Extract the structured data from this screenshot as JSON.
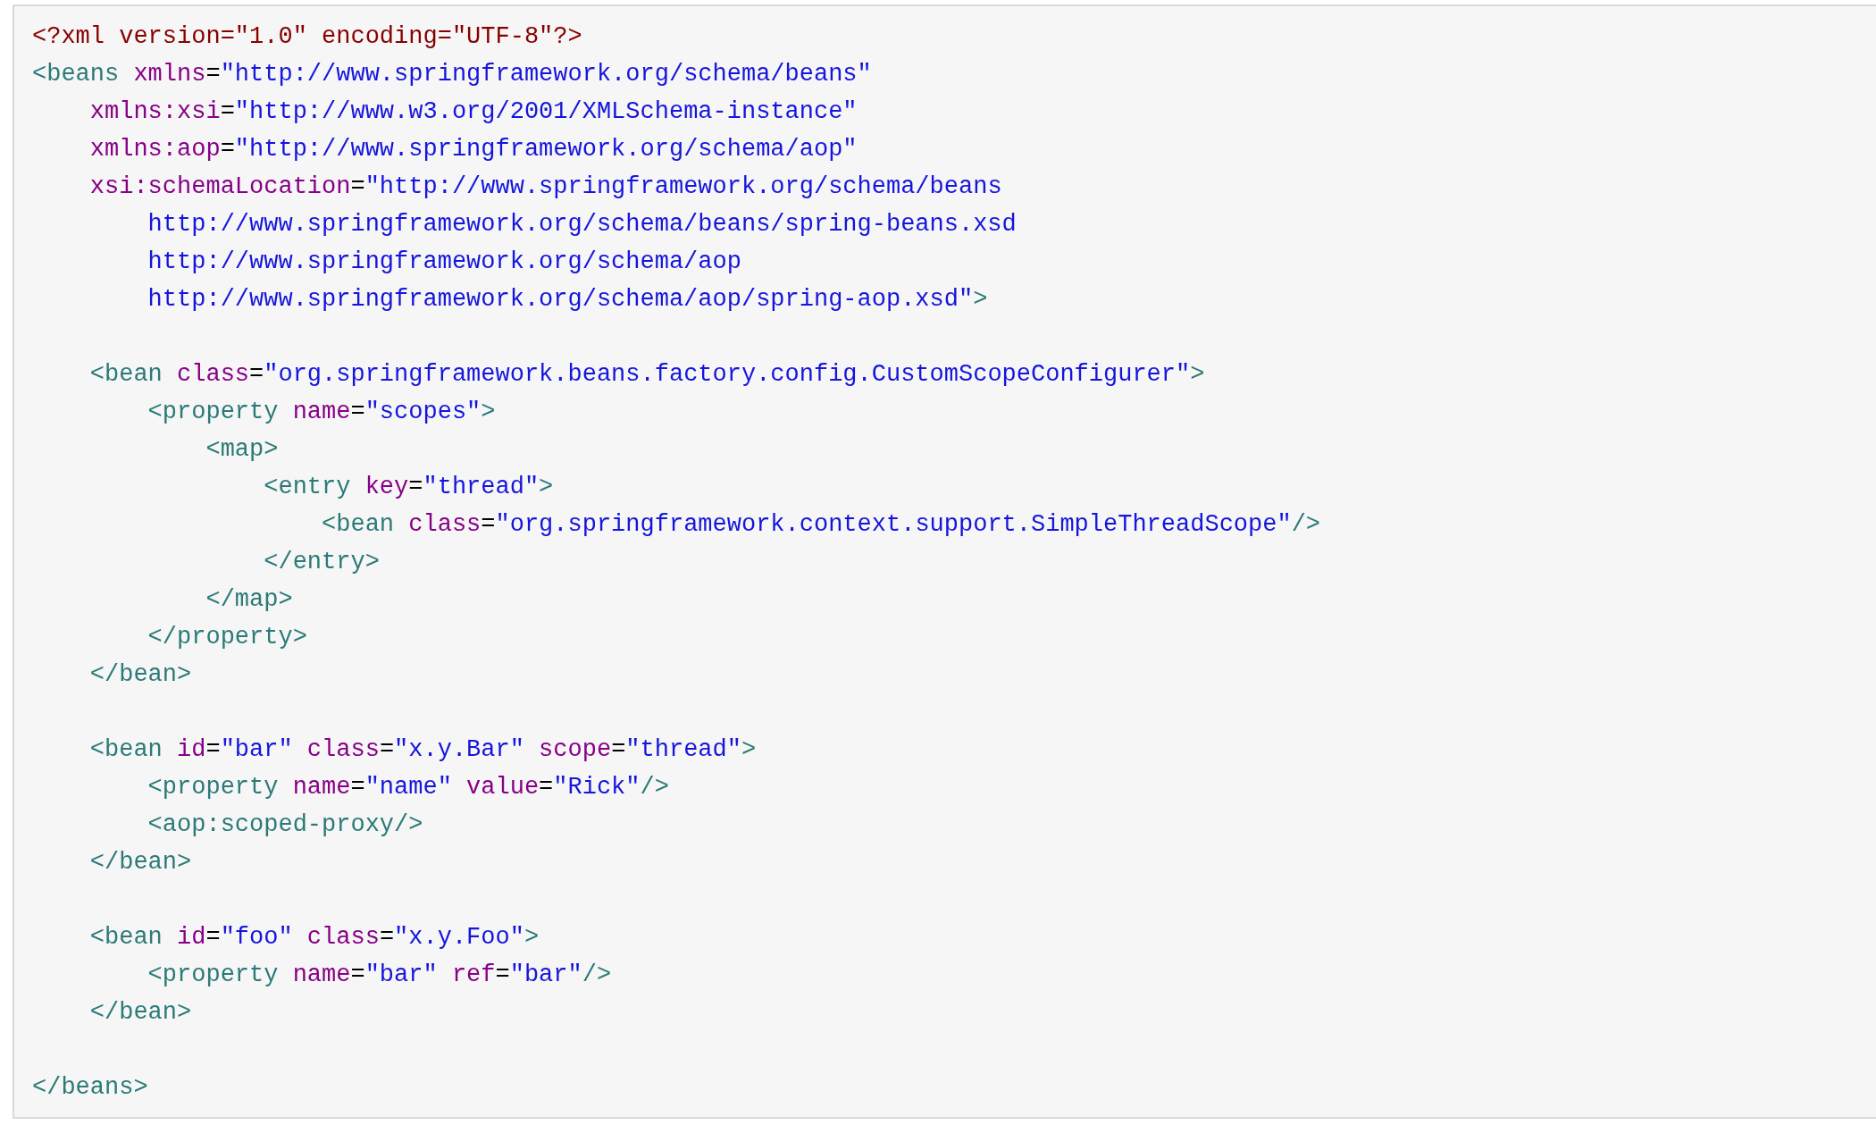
{
  "code_block": {
    "lines": [
      {
        "kind": "code",
        "tokens": [
          {
            "kind": "prolog",
            "text": "<?xml version=\"1.0\" encoding=\"UTF-8\"?>"
          }
        ]
      },
      {
        "kind": "code",
        "tokens": [
          {
            "kind": "tag",
            "text": "<beans"
          },
          {
            "kind": "attr",
            "text": " xmlns"
          },
          {
            "kind": "punct",
            "text": "="
          },
          {
            "kind": "value",
            "text": "\"http://www.springframework.org/schema/beans\""
          }
        ]
      },
      {
        "kind": "code",
        "tokens": [
          {
            "kind": "attr",
            "text": "    xmlns:xsi"
          },
          {
            "kind": "punct",
            "text": "="
          },
          {
            "kind": "value",
            "text": "\"http://www.w3.org/2001/XMLSchema-instance\""
          }
        ]
      },
      {
        "kind": "code",
        "tokens": [
          {
            "kind": "attr",
            "text": "    xmlns:aop"
          },
          {
            "kind": "punct",
            "text": "="
          },
          {
            "kind": "value",
            "text": "\"http://www.springframework.org/schema/aop\""
          }
        ]
      },
      {
        "kind": "code",
        "tokens": [
          {
            "kind": "attr",
            "text": "    xsi:schemaLocation"
          },
          {
            "kind": "punct",
            "text": "="
          },
          {
            "kind": "value",
            "text": "\"http://www.springframework.org/schema/beans"
          }
        ]
      },
      {
        "kind": "code",
        "tokens": [
          {
            "kind": "value",
            "text": "        http://www.springframework.org/schema/beans/spring-beans.xsd"
          }
        ]
      },
      {
        "kind": "code",
        "tokens": [
          {
            "kind": "value",
            "text": "        http://www.springframework.org/schema/aop"
          }
        ]
      },
      {
        "kind": "code",
        "tokens": [
          {
            "kind": "value",
            "text": "        http://www.springframework.org/schema/aop/spring-aop.xsd\""
          },
          {
            "kind": "tag",
            "text": ">"
          }
        ]
      },
      {
        "kind": "blank"
      },
      {
        "kind": "code",
        "tokens": [
          {
            "kind": "tag",
            "text": "    <bean"
          },
          {
            "kind": "attr",
            "text": " class"
          },
          {
            "kind": "punct",
            "text": "="
          },
          {
            "kind": "value",
            "text": "\"org.springframework.beans.factory.config.CustomScopeConfigurer\""
          },
          {
            "kind": "tag",
            "text": ">"
          }
        ]
      },
      {
        "kind": "code",
        "tokens": [
          {
            "kind": "tag",
            "text": "        <property"
          },
          {
            "kind": "attr",
            "text": " name"
          },
          {
            "kind": "punct",
            "text": "="
          },
          {
            "kind": "value",
            "text": "\"scopes\""
          },
          {
            "kind": "tag",
            "text": ">"
          }
        ]
      },
      {
        "kind": "code",
        "tokens": [
          {
            "kind": "tag",
            "text": "            <map>"
          }
        ]
      },
      {
        "kind": "code",
        "tokens": [
          {
            "kind": "tag",
            "text": "                <entry"
          },
          {
            "kind": "attr",
            "text": " key"
          },
          {
            "kind": "punct",
            "text": "="
          },
          {
            "kind": "value",
            "text": "\"thread\""
          },
          {
            "kind": "tag",
            "text": ">"
          }
        ]
      },
      {
        "kind": "code",
        "tokens": [
          {
            "kind": "tag",
            "text": "                    <bean"
          },
          {
            "kind": "attr",
            "text": " class"
          },
          {
            "kind": "punct",
            "text": "="
          },
          {
            "kind": "value",
            "text": "\"org.springframework.context.support.SimpleThreadScope\""
          },
          {
            "kind": "tag",
            "text": "/>"
          }
        ]
      },
      {
        "kind": "code",
        "tokens": [
          {
            "kind": "tag",
            "text": "                </entry>"
          }
        ]
      },
      {
        "kind": "code",
        "tokens": [
          {
            "kind": "tag",
            "text": "            </map>"
          }
        ]
      },
      {
        "kind": "code",
        "tokens": [
          {
            "kind": "tag",
            "text": "        </property>"
          }
        ]
      },
      {
        "kind": "code",
        "tokens": [
          {
            "kind": "tag",
            "text": "    </bean>"
          }
        ]
      },
      {
        "kind": "blank"
      },
      {
        "kind": "code",
        "tokens": [
          {
            "kind": "tag",
            "text": "    <bean"
          },
          {
            "kind": "attr",
            "text": " id"
          },
          {
            "kind": "punct",
            "text": "="
          },
          {
            "kind": "value",
            "text": "\"bar\""
          },
          {
            "kind": "attr",
            "text": " class"
          },
          {
            "kind": "punct",
            "text": "="
          },
          {
            "kind": "value",
            "text": "\"x.y.Bar\""
          },
          {
            "kind": "attr",
            "text": " scope"
          },
          {
            "kind": "punct",
            "text": "="
          },
          {
            "kind": "value",
            "text": "\"thread\""
          },
          {
            "kind": "tag",
            "text": ">"
          }
        ]
      },
      {
        "kind": "code",
        "tokens": [
          {
            "kind": "tag",
            "text": "        <property"
          },
          {
            "kind": "attr",
            "text": " name"
          },
          {
            "kind": "punct",
            "text": "="
          },
          {
            "kind": "value",
            "text": "\"name\""
          },
          {
            "kind": "attr",
            "text": " value"
          },
          {
            "kind": "punct",
            "text": "="
          },
          {
            "kind": "value",
            "text": "\"Rick\""
          },
          {
            "kind": "tag",
            "text": "/>"
          }
        ]
      },
      {
        "kind": "code",
        "tokens": [
          {
            "kind": "tag",
            "text": "        <aop:scoped-proxy/>"
          }
        ]
      },
      {
        "kind": "code",
        "tokens": [
          {
            "kind": "tag",
            "text": "    </bean>"
          }
        ]
      },
      {
        "kind": "blank"
      },
      {
        "kind": "code",
        "tokens": [
          {
            "kind": "tag",
            "text": "    <bean"
          },
          {
            "kind": "attr",
            "text": " id"
          },
          {
            "kind": "punct",
            "text": "="
          },
          {
            "kind": "value",
            "text": "\"foo\""
          },
          {
            "kind": "attr",
            "text": " class"
          },
          {
            "kind": "punct",
            "text": "="
          },
          {
            "kind": "value",
            "text": "\"x.y.Foo\""
          },
          {
            "kind": "tag",
            "text": ">"
          }
        ]
      },
      {
        "kind": "code",
        "tokens": [
          {
            "kind": "tag",
            "text": "        <property"
          },
          {
            "kind": "attr",
            "text": " name"
          },
          {
            "kind": "punct",
            "text": "="
          },
          {
            "kind": "value",
            "text": "\"bar\""
          },
          {
            "kind": "attr",
            "text": " ref"
          },
          {
            "kind": "punct",
            "text": "="
          },
          {
            "kind": "value",
            "text": "\"bar\""
          },
          {
            "kind": "tag",
            "text": "/>"
          }
        ]
      },
      {
        "kind": "code",
        "tokens": [
          {
            "kind": "tag",
            "text": "    </bean>"
          }
        ]
      },
      {
        "kind": "blank"
      },
      {
        "kind": "code",
        "tokens": [
          {
            "kind": "tag",
            "text": "</beans>"
          }
        ]
      }
    ]
  }
}
